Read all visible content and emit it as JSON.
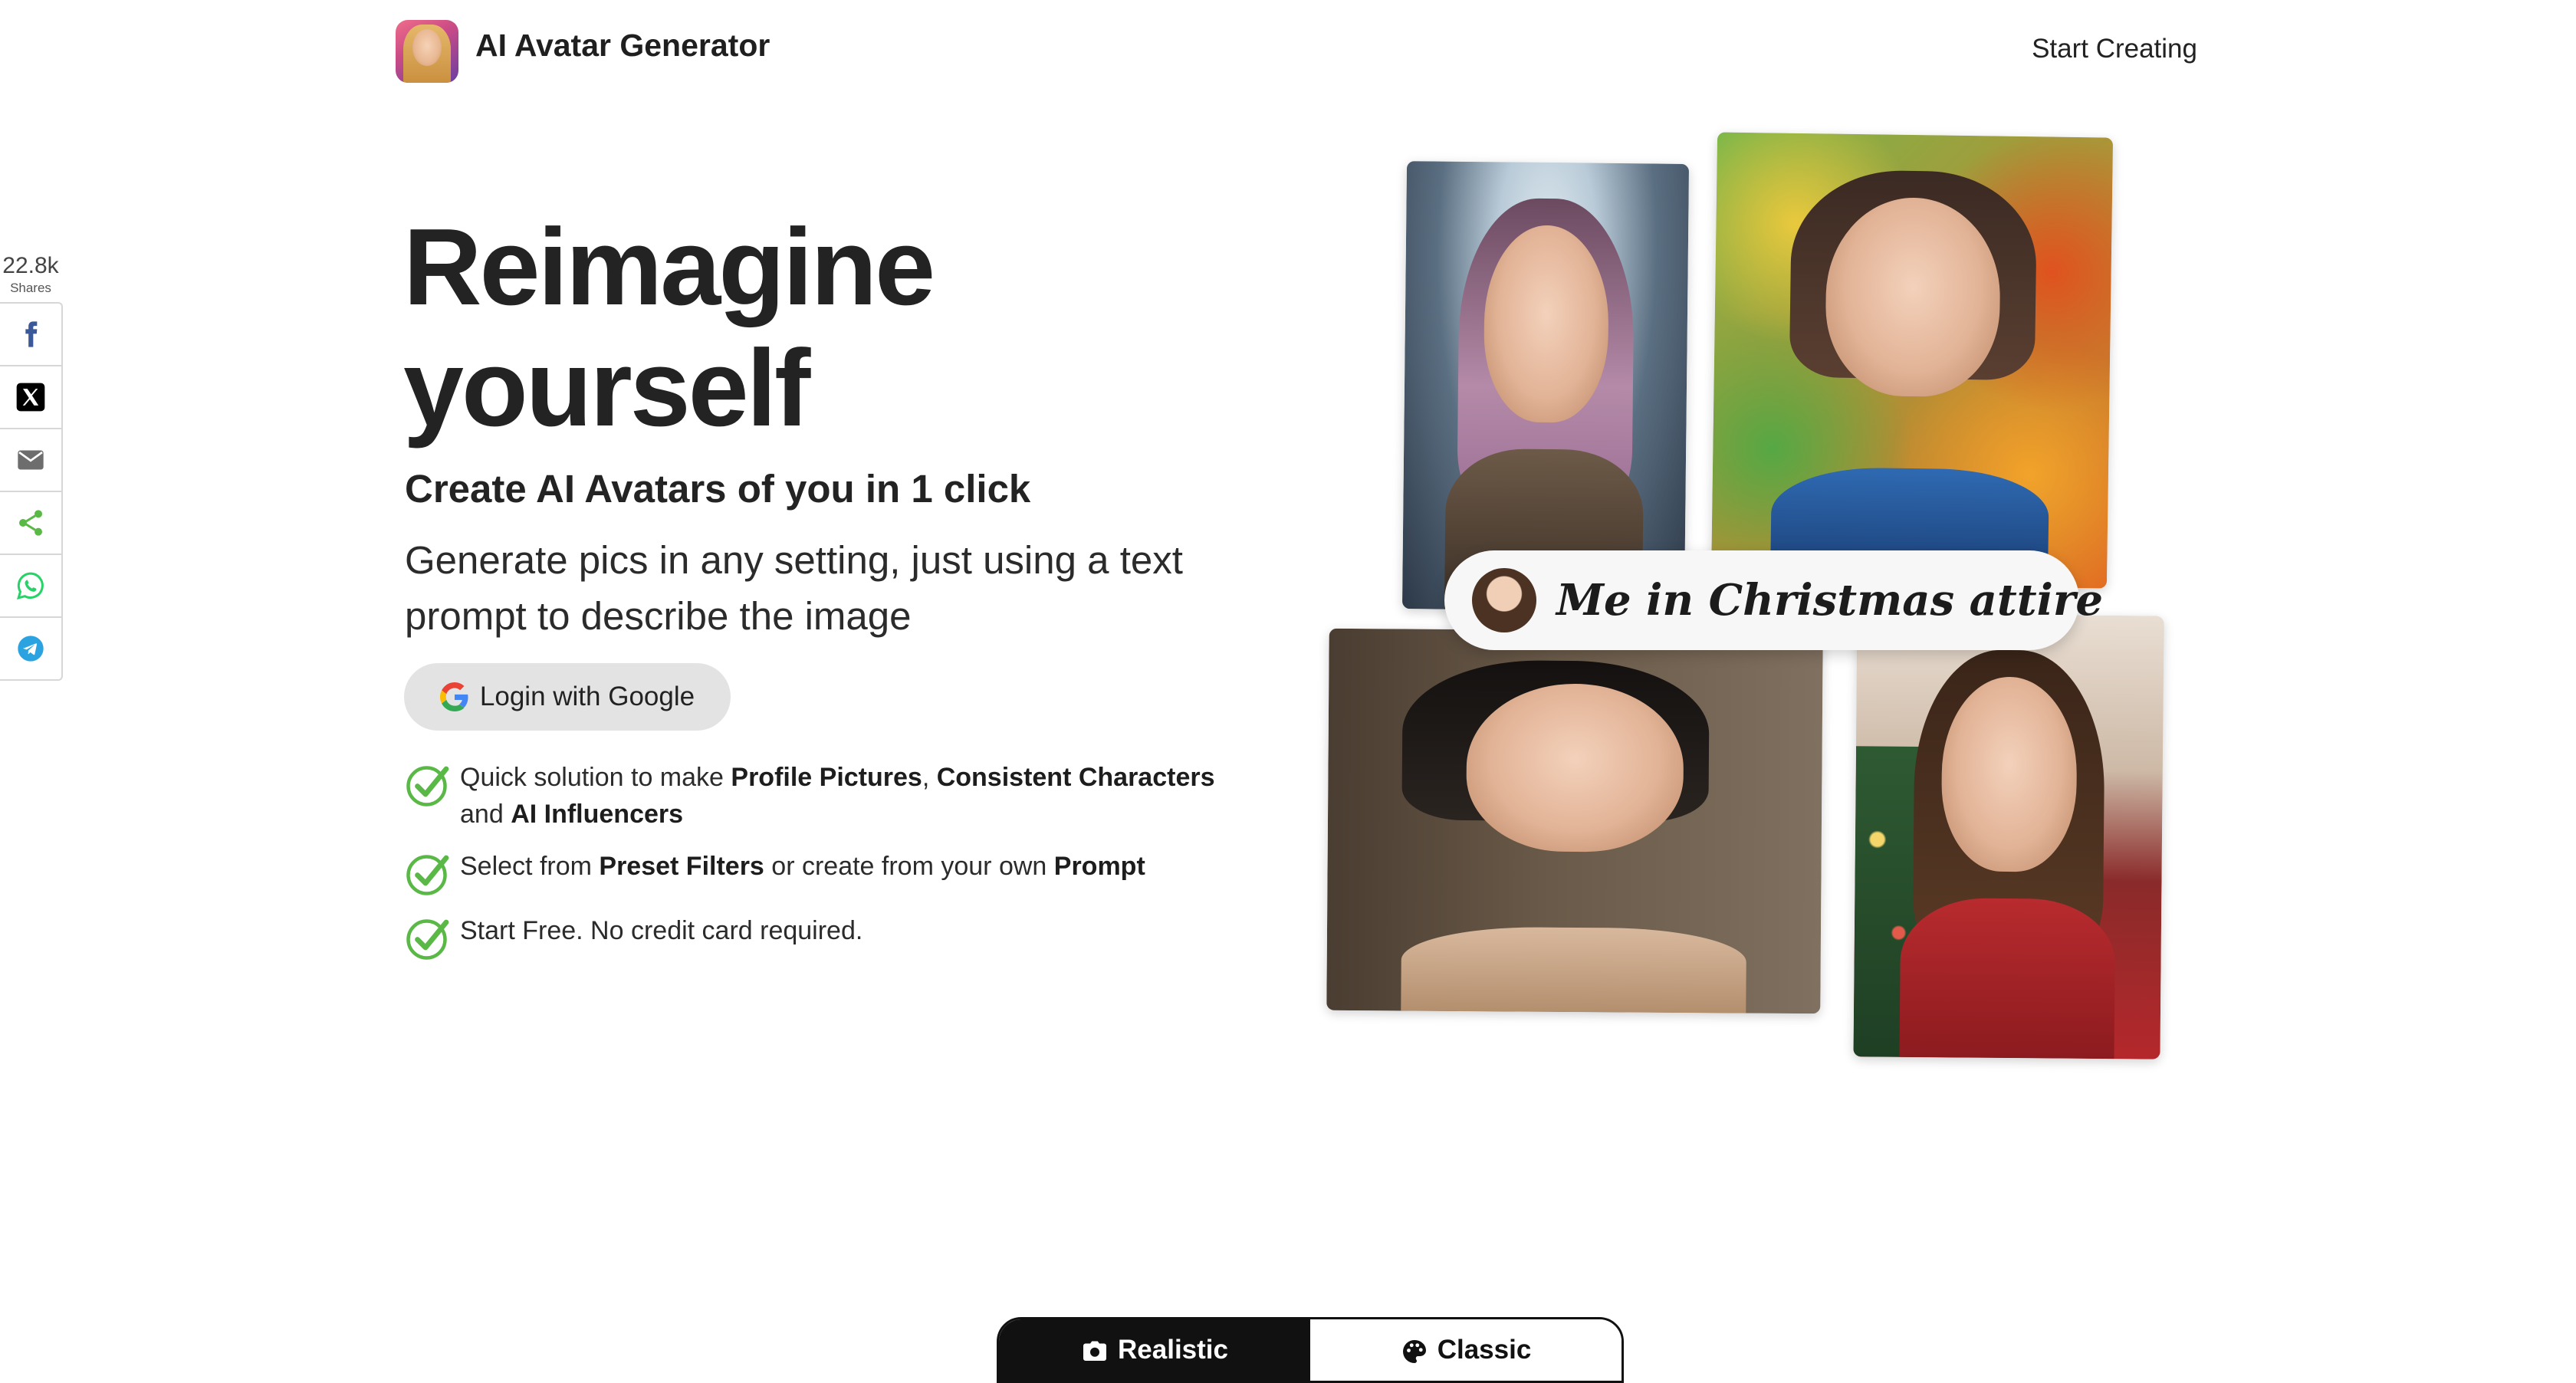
{
  "header": {
    "brand": "AI Avatar Generator",
    "nav_cta": "Start Creating"
  },
  "share": {
    "count": "22.8k",
    "label": "Shares",
    "buttons": [
      {
        "name": "facebook",
        "icon": "facebook-icon",
        "color": "#3b5998"
      },
      {
        "name": "x",
        "icon": "x-icon",
        "color": "#000000"
      },
      {
        "name": "email",
        "icon": "email-icon",
        "color": "#6d6d6d"
      },
      {
        "name": "share",
        "icon": "share-icon",
        "color": "#5ab946"
      },
      {
        "name": "whatsapp",
        "icon": "whatsapp-icon",
        "color": "#25d366"
      },
      {
        "name": "telegram",
        "icon": "telegram-icon",
        "color": "#2aa3e0"
      }
    ]
  },
  "hero": {
    "title_line1": "Reimagine",
    "title_line2": "yourself",
    "subtitle": "Create AI Avatars of you in 1 click",
    "description": "Generate pics in any setting, just using a text prompt to describe the image",
    "login_button": "Login with Google",
    "features": [
      {
        "parts": [
          "Quick solution to make ",
          "Profile Pictures",
          ", ",
          "Consistent Characters",
          " and ",
          "AI Influencers"
        ]
      },
      {
        "parts": [
          "Select from ",
          "Preset Filters",
          " or create from your own ",
          "Prompt"
        ]
      },
      {
        "parts": [
          "Start Free. No credit card required."
        ]
      }
    ],
    "prompt_example": "Me in Christmas attire"
  },
  "tabs": [
    {
      "label": "Realistic",
      "icon": "camera-icon",
      "active": true
    },
    {
      "label": "Classic",
      "icon": "palette-icon",
      "active": false
    }
  ],
  "colors": {
    "check_green": "#5ab946",
    "tab_dark": "#111111",
    "button_grey": "#e3e3e3"
  }
}
